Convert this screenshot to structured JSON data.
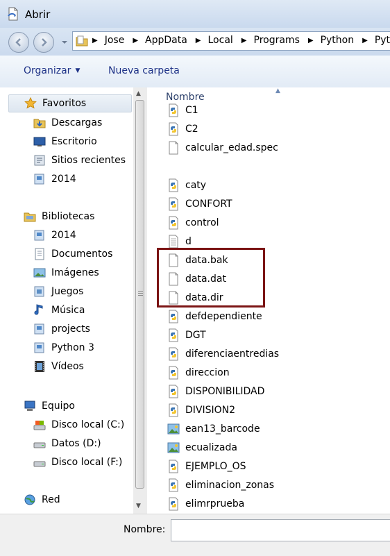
{
  "window": {
    "title": "Abrir"
  },
  "address": {
    "crumbs": [
      "Jose",
      "AppData",
      "Local",
      "Programs",
      "Python",
      "Pyt"
    ]
  },
  "toolbar": {
    "organize_label": "Organizar",
    "new_folder_label": "Nueva carpeta"
  },
  "nav": {
    "favorites": {
      "label": "Favoritos",
      "items": [
        "Descargas",
        "Escritorio",
        "Sitios recientes",
        "2014"
      ]
    },
    "libraries": {
      "label": "Bibliotecas",
      "items": [
        "2014",
        "Documentos",
        "Imágenes",
        "Juegos",
        "Música",
        "projects",
        "Python 3",
        "Vídeos"
      ]
    },
    "computer": {
      "label": "Equipo",
      "items": [
        "Disco local (C:)",
        "Datos (D:)",
        "Disco local (F:)"
      ]
    },
    "network": {
      "label": "Red"
    }
  },
  "files": {
    "column_header": "Nombre",
    "items": [
      {
        "name": "C1",
        "icon": "python-file-icon"
      },
      {
        "name": "C2",
        "icon": "python-file-icon"
      },
      {
        "name": "calcular_edad.spec",
        "icon": "blank-file-icon"
      },
      {
        "name": "caty",
        "icon": "python-file-icon"
      },
      {
        "name": "CONFORT",
        "icon": "python-file-icon"
      },
      {
        "name": "control",
        "icon": "python-file-icon"
      },
      {
        "name": "d",
        "icon": "text-file-icon"
      },
      {
        "name": "data.bak",
        "icon": "blank-file-icon"
      },
      {
        "name": "data.dat",
        "icon": "blank-file-icon"
      },
      {
        "name": "data.dir",
        "icon": "blank-file-icon"
      },
      {
        "name": "defdependiente",
        "icon": "python-file-icon"
      },
      {
        "name": "DGT",
        "icon": "python-file-icon"
      },
      {
        "name": "diferenciaentredias",
        "icon": "python-file-icon"
      },
      {
        "name": "direccion",
        "icon": "python-file-icon"
      },
      {
        "name": "DISPONIBILIDAD",
        "icon": "python-file-icon"
      },
      {
        "name": "DIVISION2",
        "icon": "python-file-icon"
      },
      {
        "name": "ean13_barcode",
        "icon": "image-file-icon"
      },
      {
        "name": "ecualizada",
        "icon": "image-file-icon"
      },
      {
        "name": "EJEMPLO_OS",
        "icon": "python-file-icon"
      },
      {
        "name": "eliminacion_zonas",
        "icon": "python-file-icon"
      },
      {
        "name": "elimrprueba",
        "icon": "python-file-icon"
      }
    ]
  },
  "footer": {
    "name_label": "Nombre:",
    "name_value": ""
  }
}
